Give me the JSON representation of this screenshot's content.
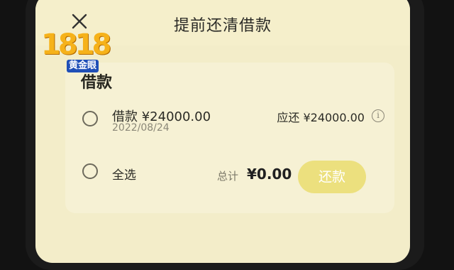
{
  "header": {
    "title": "提前还清借款"
  },
  "section": {
    "title": "借款"
  },
  "loan": {
    "name": "借款 ¥24000.00",
    "date": "2022/08/24",
    "due": "应还 ¥24000.00"
  },
  "footer": {
    "select_all": "全选",
    "total_label": "总计",
    "total_value": "¥0.00",
    "repay_label": "还款"
  },
  "watermark": {
    "digits": "1818",
    "sub": "黄金眼"
  },
  "colors": {
    "screen_bg": "#f3edc9",
    "card_bg": "#f6f1d4",
    "button": "#ece07e",
    "text": "#2b2b25",
    "muted": "#8b8878"
  },
  "icons": {
    "close": "close-icon",
    "info": "info-icon",
    "radio": "radio-unchecked-icon"
  }
}
